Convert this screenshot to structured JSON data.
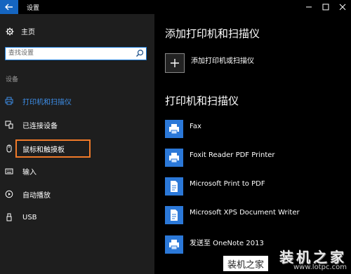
{
  "window": {
    "title": "设置"
  },
  "sidebar": {
    "home_label": "主页",
    "search_placeholder": "查找设置",
    "section_label": "设备",
    "items": [
      {
        "label": "打印机和扫描仪",
        "active": true
      },
      {
        "label": "已连接设备"
      },
      {
        "label": "鼠标和触摸板"
      },
      {
        "label": "输入"
      },
      {
        "label": "自动播放"
      },
      {
        "label": "USB"
      }
    ]
  },
  "main": {
    "add_heading": "添加打印机和扫描仪",
    "add_button_label": "添加打印机或扫描仪",
    "printers_heading": "打印机和扫描仪",
    "printers": [
      {
        "name": "Fax"
      },
      {
        "name": "Foxit Reader PDF Printer"
      },
      {
        "name": "Microsoft Print to PDF"
      },
      {
        "name": "Microsoft XPS Document Writer"
      },
      {
        "name": "发送至 OneNote 2013"
      }
    ]
  },
  "watermark": {
    "big": "装机之家",
    "small": "装机之家",
    "url": "www.lotpc.com"
  },
  "colors": {
    "accent": "#3d8ee8",
    "titlebar_back": "#1565c0",
    "printer_icon_bg": "#2b78d8",
    "highlight": "#f07a29"
  }
}
